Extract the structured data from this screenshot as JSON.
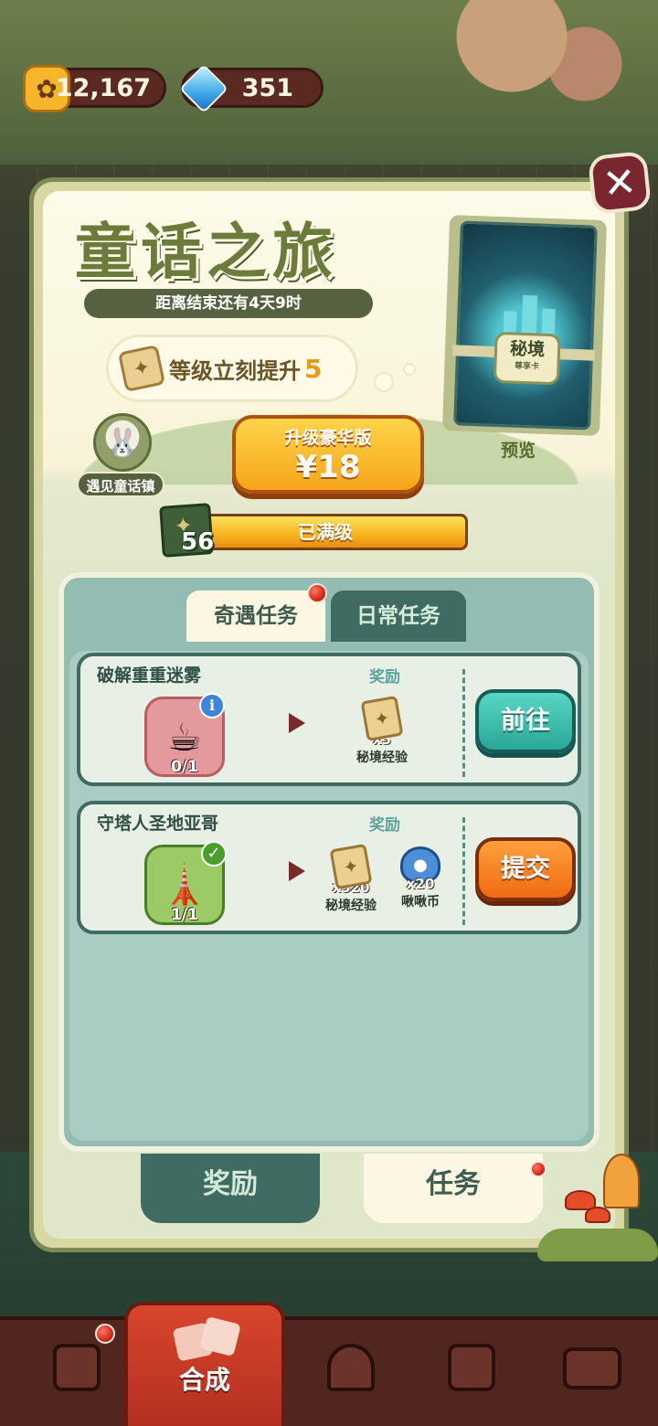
{
  "currency": {
    "paws": "12,167",
    "gems": "351"
  },
  "panel": {
    "title": "童话之旅",
    "timer": "距离结束还有4天9时",
    "level_boost_text": "等级立刻提升",
    "level_boost_value": "5",
    "town_label": "遇见童话镇",
    "upgrade_label": "升级豪华版",
    "upgrade_price": "¥18",
    "card_title": "秘境",
    "card_subtitle": "尊享卡",
    "preview_label": "预览",
    "level": "56",
    "level_status": "已满级"
  },
  "tabs": [
    {
      "label": "奇遇任务",
      "active": true
    },
    {
      "label": "日常任务",
      "active": false
    }
  ],
  "tasks": [
    {
      "name": "破解重重迷雾",
      "reward_header": "奖励",
      "progress": "0/1",
      "rewards": [
        {
          "amount": "x5",
          "label": "秘境经验",
          "icon": "scroll-icon"
        }
      ],
      "action": "前往"
    },
    {
      "name": "守塔人圣地亚哥",
      "reward_header": "奖励",
      "progress": "1/1",
      "rewards": [
        {
          "amount": "x520",
          "label": "秘境经验",
          "icon": "scroll-icon"
        },
        {
          "amount": "x20",
          "label": "啾啾币",
          "icon": "bird-icon"
        }
      ],
      "action": "提交"
    }
  ],
  "panel_tabs": {
    "rewards": "奖励",
    "tasks": "任务"
  },
  "nav": {
    "active_label": "合成"
  },
  "colors": {
    "accent_orange": "#f5a51a",
    "teal_button": "#2aa696",
    "panel_bg": "#fdfbe9",
    "dark_teal": "#3f6b63"
  }
}
